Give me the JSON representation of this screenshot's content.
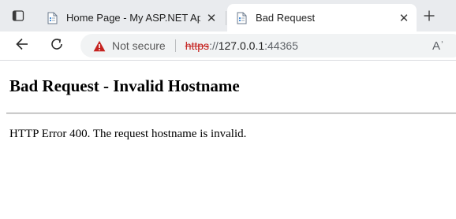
{
  "browser": {
    "tabs": [
      {
        "title": "Home Page - My ASP.NET Applic",
        "active": false,
        "icon": "page-icon",
        "close": "✕"
      },
      {
        "title": "Bad Request",
        "active": true,
        "icon": "page-icon",
        "close": "✕"
      }
    ],
    "new_tab": "+",
    "address_bar": {
      "security_label": "Not secure",
      "url_scheme": "https",
      "url_separator": "://",
      "url_host": "127.0.0.1",
      "url_port": ":44365",
      "reader_icon": "Aʾ"
    }
  },
  "page": {
    "heading": "Bad Request - Invalid Hostname",
    "message": "HTTP Error 400. The request hostname is invalid."
  },
  "colors": {
    "warning": "#c5221f",
    "tabstrip_bg": "#e9ebee",
    "address_bg": "#f1f3f4"
  }
}
